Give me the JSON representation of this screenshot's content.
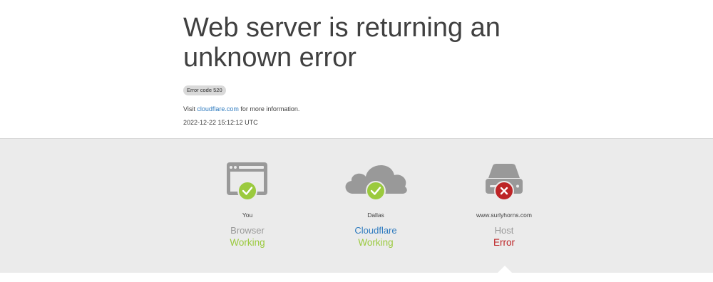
{
  "header": {
    "title": "Web server is returning an unknown error",
    "error_badge": "Error code 520",
    "info_prefix": "Visit ",
    "info_link": "cloudflare.com",
    "info_suffix": " for more information.",
    "timestamp": "2022-12-22 15:12:12 UTC"
  },
  "nodes": [
    {
      "location": "You",
      "role": "Browser",
      "status": "Working",
      "icon": "browser-icon",
      "status_icon": "check-icon"
    },
    {
      "location": "Dallas",
      "role": "Cloudflare",
      "status": "Working",
      "icon": "cloud-icon",
      "status_icon": "check-icon"
    },
    {
      "location": "www.surlyhorns.com",
      "role": "Host",
      "status": "Error",
      "icon": "server-icon",
      "status_icon": "x-icon"
    }
  ],
  "colors": {
    "ok": "#9bca3e",
    "error": "#bd2426",
    "link": "#2f7bbf",
    "icon_gray": "#999999",
    "panel_bg": "#ebebeb"
  }
}
